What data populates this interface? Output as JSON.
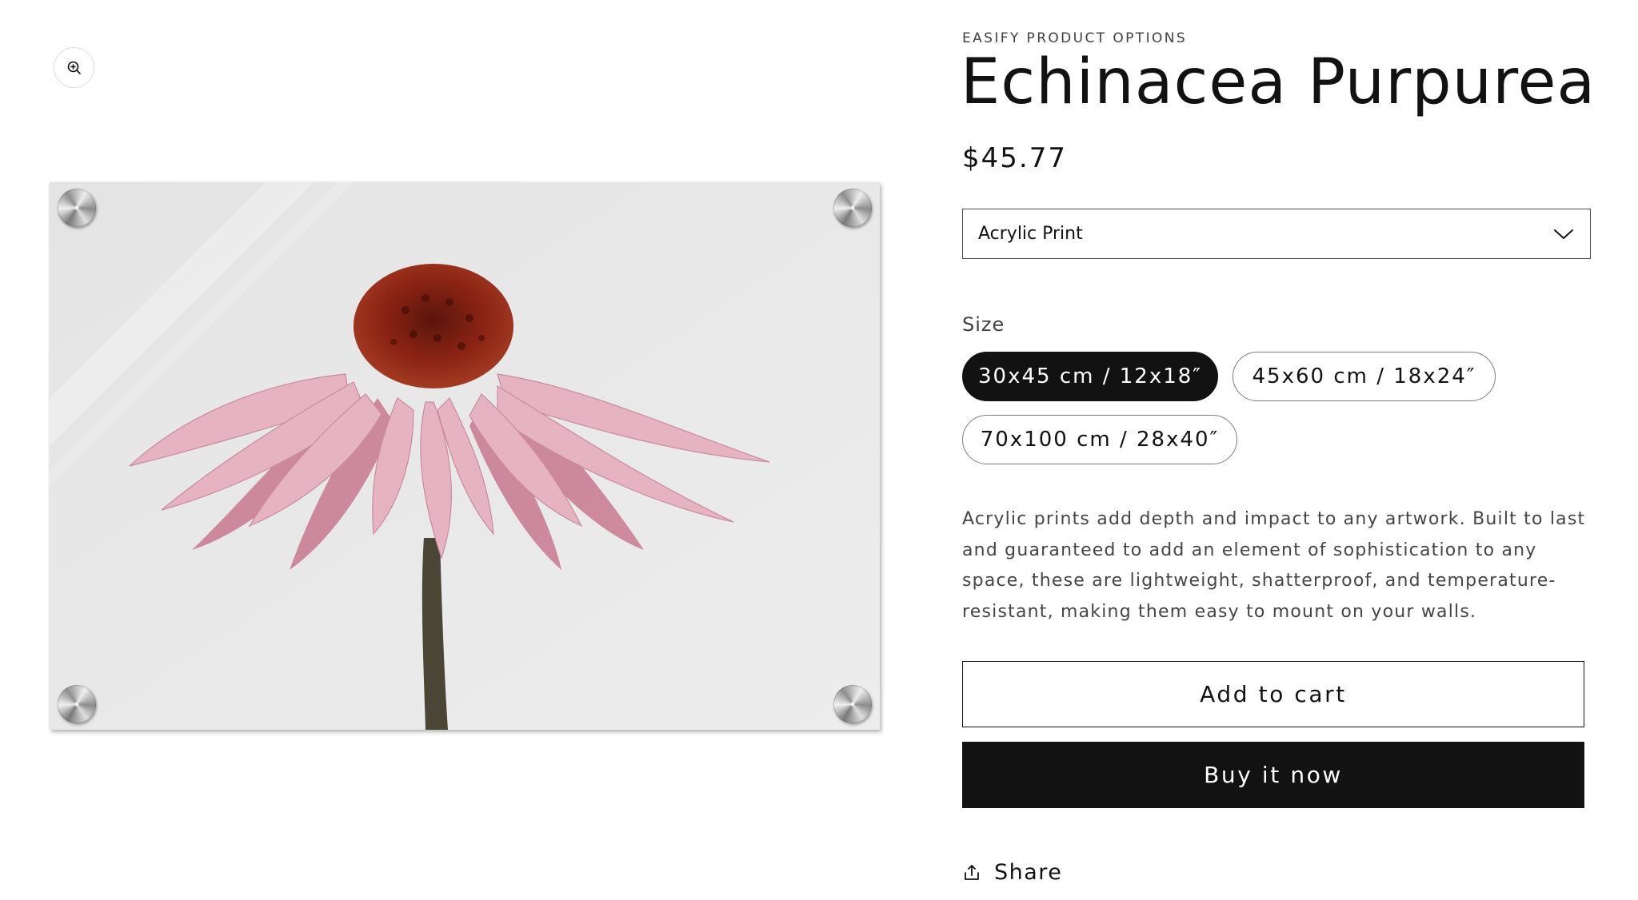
{
  "product": {
    "vendor": "EASIFY PRODUCT OPTIONS",
    "title": "Echinacea Purpurea",
    "price": "$45.77",
    "description": "Acrylic prints add depth and impact to any artwork. Built to last and guaranteed to add an element of sophistication to any space, these are lightweight, shatterproof, and temperature-resistant, making them easy to mount on your walls."
  },
  "gallery": {
    "zoom_icon": "zoom-in-icon"
  },
  "options": {
    "material": {
      "selected": "Acrylic Print",
      "icon": "chevron-down-icon"
    },
    "size": {
      "label": "Size",
      "values": [
        "30x45 cm / 12x18″",
        "45x60 cm / 18x24″",
        "70x100 cm / 28x40″"
      ],
      "selected_index": 0
    }
  },
  "actions": {
    "add_to_cart": "Add to cart",
    "buy_now": "Buy it now",
    "share": "Share",
    "share_icon": "share-icon"
  },
  "colors": {
    "text": "#121212",
    "accent": "#121212",
    "background": "#ffffff"
  }
}
